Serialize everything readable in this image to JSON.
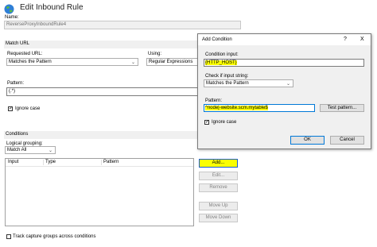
{
  "title": "Edit Inbound Rule",
  "name_label": "Name:",
  "name_value": "ReverseProxyInboundRule4",
  "match_url": {
    "header": "Match URL",
    "requested_label": "Requested URL:",
    "requested_value": "Matches the Pattern",
    "using_label": "Using:",
    "using_value": "Regular Expressions",
    "pattern_label": "Pattern:",
    "pattern_value": "(.*)",
    "ignore_case_label": "Ignore case"
  },
  "conditions": {
    "header": "Conditions",
    "grouping_label": "Logical grouping:",
    "grouping_value": "Match All",
    "columns": [
      "Input",
      "Type",
      "Pattern"
    ],
    "buttons": {
      "add": "Add...",
      "edit": "Edit...",
      "remove": "Remove",
      "move_up": "Move Up",
      "move_down": "Move Down"
    },
    "track_label": "Track capture groups across conditions"
  },
  "dialog": {
    "title": "Add Condition",
    "help": "?",
    "close": "X",
    "input_label": "Condition input:",
    "input_value": "{HTTP_HOST}",
    "check_label": "Check if input string:",
    "check_value": "Matches the Pattern",
    "pattern_label": "Pattern:",
    "pattern_value": "^node|-website.scm.mytable$",
    "test_button": "Test pattern...",
    "ignore_case_label": "Ignore case",
    "ok": "OK",
    "cancel": "Cancel"
  }
}
